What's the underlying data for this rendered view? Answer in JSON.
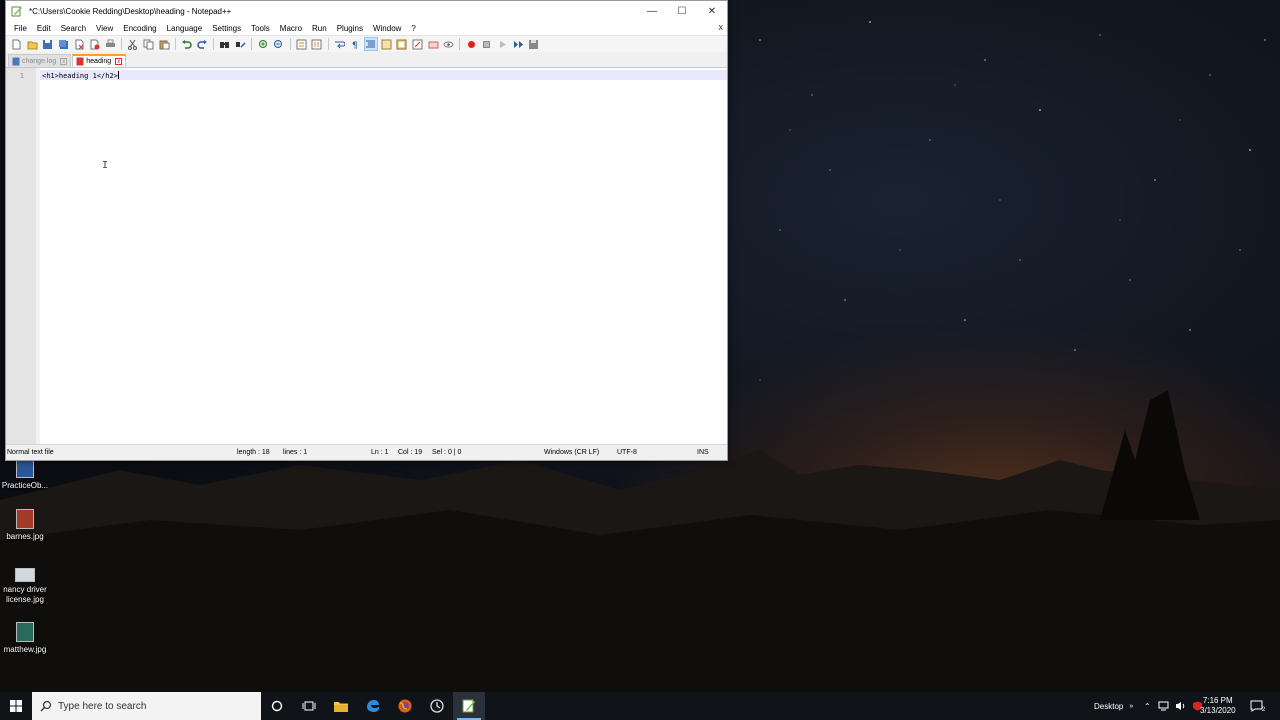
{
  "window": {
    "title": "*C:\\Users\\Cookie Redding\\Desktop\\heading - Notepad++",
    "controls": {
      "minimize": "—",
      "maximize": "☐",
      "close": "✕"
    }
  },
  "menu": [
    "File",
    "Edit",
    "Search",
    "View",
    "Encoding",
    "Language",
    "Settings",
    "Tools",
    "Macro",
    "Run",
    "Plugins",
    "Window",
    "?"
  ],
  "menu_close": "x",
  "tabs": [
    {
      "label": "change.log",
      "active": false
    },
    {
      "label": "heading",
      "active": true
    }
  ],
  "editor": {
    "line_number": "1",
    "line_text": "<h1>heading 1</h2>"
  },
  "status": {
    "file_type": "Normal text file",
    "length": "length : 18",
    "lines": "lines : 1",
    "ln": "Ln : 1",
    "col": "Col : 19",
    "sel": "Sel : 0 | 0",
    "eol": "Windows (CR LF)",
    "encoding": "UTF-8",
    "mode": "INS"
  },
  "desktop_icons": [
    {
      "label": "PracticeOb...",
      "icon": "word-doc-icon",
      "color": "#2b5797"
    },
    {
      "label": "barnes.jpg",
      "icon": "image-icon",
      "color": "#a33a2a"
    },
    {
      "label": "nancy driver license.jpg",
      "icon": "image-icon",
      "color": "#d0d8e0"
    },
    {
      "label": "matthew.jpg",
      "icon": "image-icon",
      "color": "#2a6a5a"
    }
  ],
  "taskbar": {
    "search_placeholder": "Type here to search",
    "desktop_label": "Desktop",
    "time": "7:16 PM",
    "date": "3/13/2020",
    "notification_count": "2"
  },
  "colors": {
    "tab_accent": "#f7a21b",
    "current_line": "#e8e8ff",
    "taskbar": "#101318"
  }
}
